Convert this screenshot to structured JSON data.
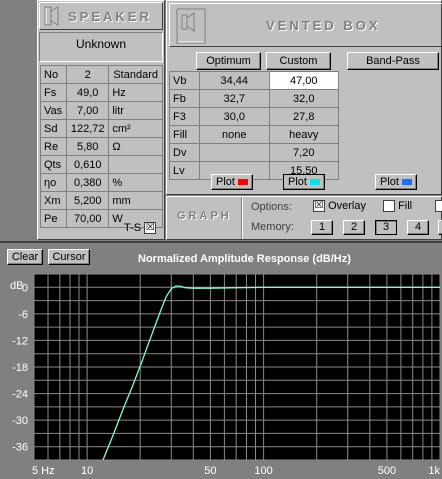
{
  "speaker": {
    "title": "SPEAKER",
    "name": "Unknown",
    "no_label": "No",
    "no_value": "2",
    "standard_label": "Standard",
    "params": [
      {
        "label": "Fs",
        "value": "49,0",
        "unit": "Hz"
      },
      {
        "label": "Vas",
        "value": "7,00",
        "unit": "litr"
      },
      {
        "label": "Sd",
        "value": "122,72",
        "unit": "cm²"
      },
      {
        "label": "Re",
        "value": "5,80",
        "unit": "Ω"
      },
      {
        "label": "Qts",
        "value": "0,610",
        "unit": ""
      },
      {
        "label": "ηo",
        "value": "0,380",
        "unit": "%"
      },
      {
        "label": "Xm",
        "value": "5,200",
        "unit": "mm"
      },
      {
        "label": "Pe",
        "value": "70,00",
        "unit": "W"
      }
    ],
    "ts_label": "T-S",
    "ts_checked": "☒"
  },
  "box": {
    "title": "VENTED BOX",
    "columns": [
      "Optimum",
      "Custom",
      "Band-Pass"
    ],
    "rows": [
      {
        "label": "Vb",
        "optimum": "34,44",
        "custom": "47,00"
      },
      {
        "label": "Fb",
        "optimum": "32,7",
        "custom": "32,0"
      },
      {
        "label": "F3",
        "optimum": "30,0",
        "custom": "27,8"
      },
      {
        "label": "Fill",
        "optimum": "none",
        "custom": "heavy"
      },
      {
        "label": "Dv",
        "optimum": "",
        "custom": "7,20"
      },
      {
        "label": "Lv",
        "optimum": "",
        "custom": "15,50"
      }
    ],
    "plot_label": "Plot",
    "plot_colors": [
      "#ff0000",
      "#00e5ee",
      "#1e6fff"
    ]
  },
  "graph": {
    "title": "GRAPH",
    "options_label": "Options:",
    "overlay_label": "Overlay",
    "overlay_checked": "☒",
    "fill_label": "Fill",
    "memory_label": "Memory:",
    "memory_buttons": [
      "1",
      "2",
      "3",
      "4"
    ],
    "memory_selected": "3"
  },
  "chart_toolbar": {
    "clear_label": "Clear",
    "cursor_label": "Cursor"
  },
  "chart_data": {
    "type": "line",
    "title": "Normalized Amplitude Response (dB/Hz)",
    "ylabel": "dB",
    "xscale": "log",
    "xlim": [
      5,
      1000
    ],
    "ylim": [
      -39,
      3
    ],
    "yticks": [
      0,
      -6,
      -12,
      -18,
      -24,
      -30,
      -36
    ],
    "xtick_labels": [
      {
        "value": 5,
        "label": "5 Hz"
      },
      {
        "value": 10,
        "label": "10"
      },
      {
        "value": 50,
        "label": "50"
      },
      {
        "value": 100,
        "label": "100"
      },
      {
        "value": 500,
        "label": "500"
      },
      {
        "value": 1000,
        "label": "1k"
      }
    ],
    "grid": true,
    "background": "#000000",
    "line_color": "#7fffd4",
    "series": [
      {
        "x": [
          12.3,
          14,
          16,
          18,
          20,
          22,
          24,
          26,
          28,
          30,
          32,
          34,
          36,
          40,
          50,
          70,
          100,
          200,
          500,
          1000
        ],
        "y": [
          -39,
          -33.5,
          -27.5,
          -22.5,
          -17.8,
          -13.3,
          -9.2,
          -5.5,
          -2.2,
          -0.3,
          0.3,
          0.2,
          -0.1,
          -0.2,
          -0.2,
          -0.1,
          0.0,
          0.0,
          0.0,
          0.0
        ]
      }
    ]
  }
}
